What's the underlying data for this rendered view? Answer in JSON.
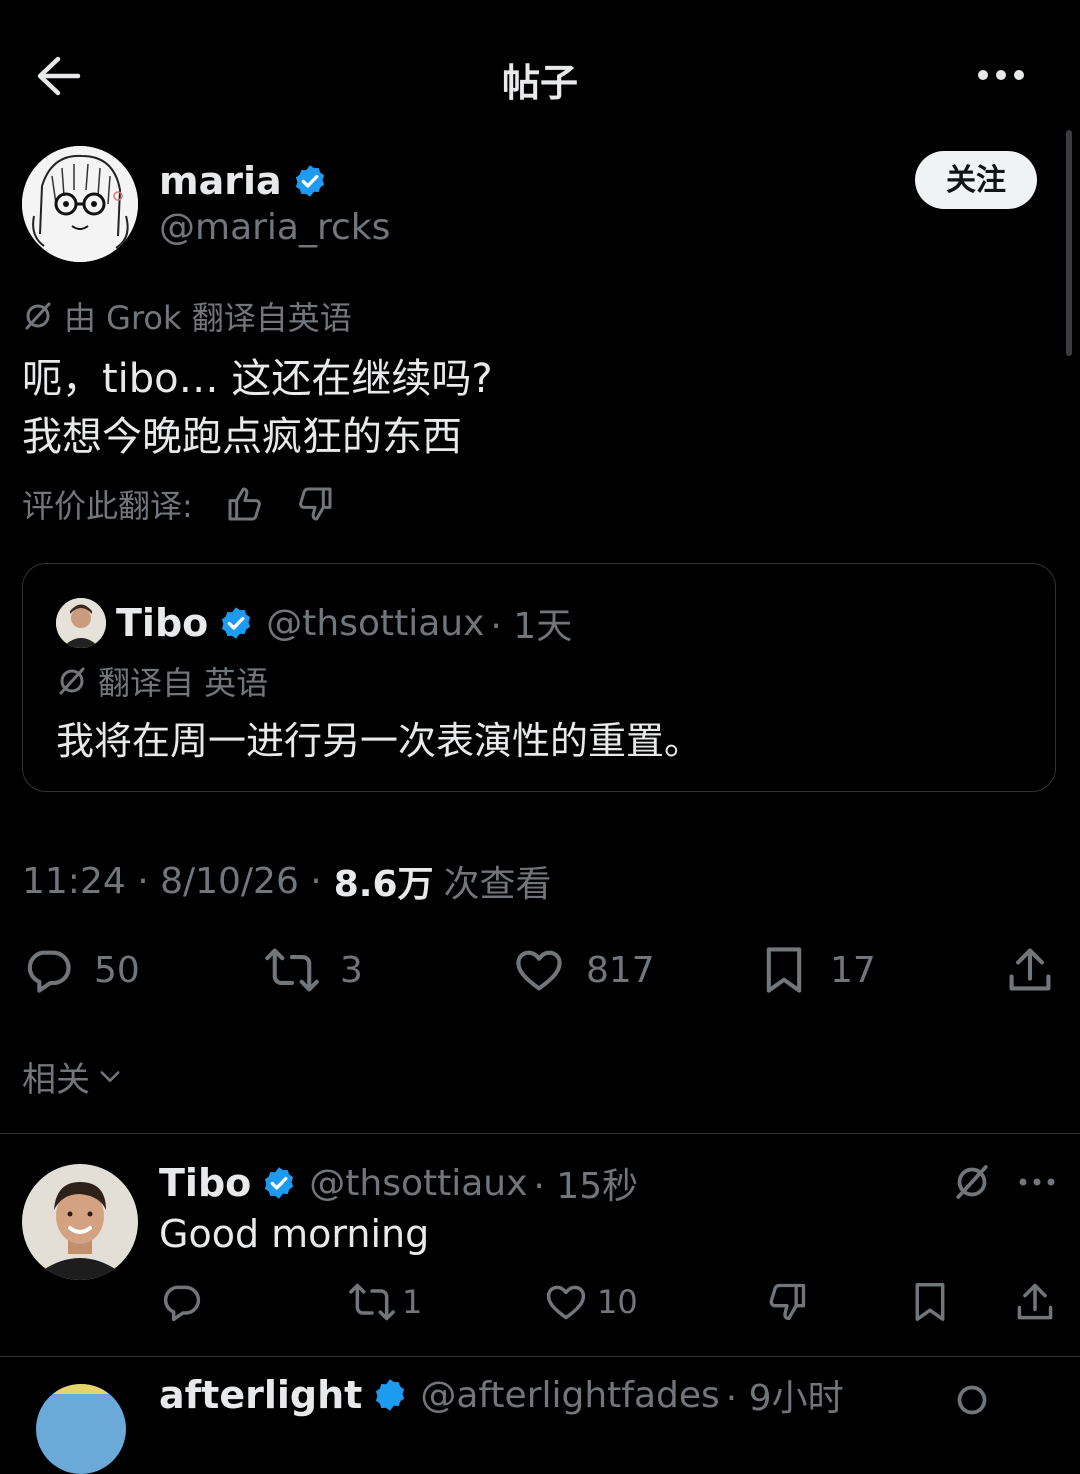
{
  "header": {
    "title": "帖子"
  },
  "post": {
    "author_name": "maria",
    "author_handle": "@maria_rcks",
    "follow_label": "关注",
    "translation_note": "由 Grok 翻译自英语",
    "text_line1": "呃，tibo… 这还在继续吗?",
    "text_line2": "我想今晚跑点疯狂的东西",
    "rate_label": "评价此翻译:",
    "quote": {
      "author_name": "Tibo",
      "author_handle": "@thsottiaux",
      "time": "· 1天",
      "translation_note": "翻译自 英语",
      "text": "我将在周一进行另一次表演性的重置。"
    },
    "timestamp": "11:24 · 8/10/26 ·",
    "views_count": "8.6万",
    "views_label": "次查看",
    "actions": {
      "replies": "50",
      "reposts": "3",
      "likes": "817",
      "bookmarks": "17"
    }
  },
  "related": {
    "label": "相关"
  },
  "reply": {
    "author_name": "Tibo",
    "author_handle": "@thsottiaux",
    "time": "· 15秒",
    "text": "Good morning",
    "actions": {
      "reposts": "1",
      "likes": "10"
    }
  },
  "next_reply": {
    "author_name": "afterlight",
    "author_handle": "@afterlightfades",
    "time": "· 9小时"
  },
  "colors": {
    "verified": "#1d9bf0",
    "background": "#000000",
    "muted": "#71767b",
    "text": "#e7e9ea",
    "border": "#2f3336"
  }
}
